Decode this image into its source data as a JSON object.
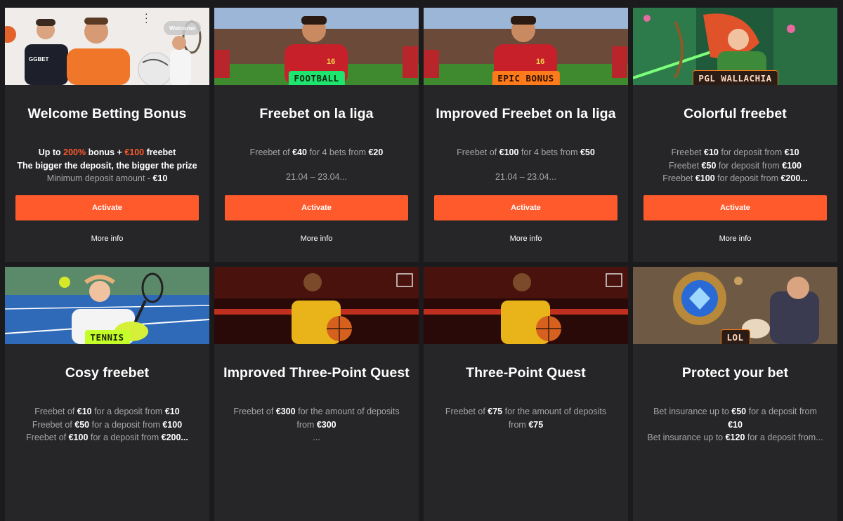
{
  "colors": {
    "accent": "#ff5a2c",
    "card_bg": "#262628",
    "page_bg": "#1b1b1d"
  },
  "cards": [
    {
      "banner_tag": "",
      "banner_badge": "Welcome",
      "title": "Welcome Betting Bonus",
      "line1_a": "Up to ",
      "line1_hl1": "200%",
      "line1_b": " bonus + ",
      "line1_hl2": "€100",
      "line1_c": " freebet",
      "line2": "The bigger the deposit, the bigger the prize",
      "line3_a": "Minimum deposit amount - ",
      "line3_b": "€10",
      "activate": "Activate",
      "more": "More info"
    },
    {
      "banner_tag": "FOOTBALL",
      "title": "Freebet on la liga",
      "d_a": "Freebet of ",
      "d_b": "€40",
      "d_c": " for 4 bets from ",
      "d_d": "€20",
      "date": "21.04 – 23.04...",
      "activate": "Activate",
      "more": "More info"
    },
    {
      "banner_tag": "EPIC BONUS",
      "title": "Improved Freebet on la liga",
      "d_a": "Freebet of ",
      "d_b": "€100",
      "d_c": " for 4 bets from ",
      "d_d": "€50",
      "date": "21.04 – 23.04...",
      "activate": "Activate",
      "more": "More info"
    },
    {
      "banner_tag": "PGL WALLACHIA",
      "title": "Colorful freebet",
      "lines": [
        {
          "a": "Freebet ",
          "b": "€10",
          "c": " for deposit from ",
          "d": "€10"
        },
        {
          "a": "Freebet ",
          "b": "€50",
          "c": " for deposit from ",
          "d": "€100"
        },
        {
          "a": "Freebet ",
          "b": "€100",
          "c": " for deposit from ",
          "d": "€200..."
        }
      ],
      "activate": "Activate",
      "more": "More info"
    },
    {
      "banner_tag": "TENNIS",
      "title": "Cosy freebet",
      "lines": [
        {
          "a": "Freebet of ",
          "b": "€10",
          "c": " for a deposit from ",
          "d": "€10"
        },
        {
          "a": "Freebet of ",
          "b": "€50",
          "c": " for a deposit from ",
          "d": "€100"
        },
        {
          "a": "Freebet of ",
          "b": "€100",
          "c": " for a deposit from ",
          "d": "€200..."
        }
      ]
    },
    {
      "banner_tag": "",
      "title": "Improved Three-Point Quest",
      "l1_a": "Freebet of ",
      "l1_b": "€300",
      "l1_c": " for the amount of deposits",
      "l2_a": "from ",
      "l2_b": "€300",
      "l3": "..."
    },
    {
      "banner_tag": "",
      "title": "Three-Point Quest",
      "l1_a": "Freebet of ",
      "l1_b": "€75",
      "l1_c": " for the amount of deposits",
      "l2_a": "from ",
      "l2_b": "€75"
    },
    {
      "banner_tag": "LOL",
      "title": "Protect your bet",
      "l1_a": "Bet insurance up to ",
      "l1_b": "€50",
      "l1_c": " for a deposit from",
      "l2_b": "€10",
      "l3_a": "Bet insurance up to ",
      "l3_b": "€120",
      "l3_c": " for a deposit from..."
    }
  ]
}
